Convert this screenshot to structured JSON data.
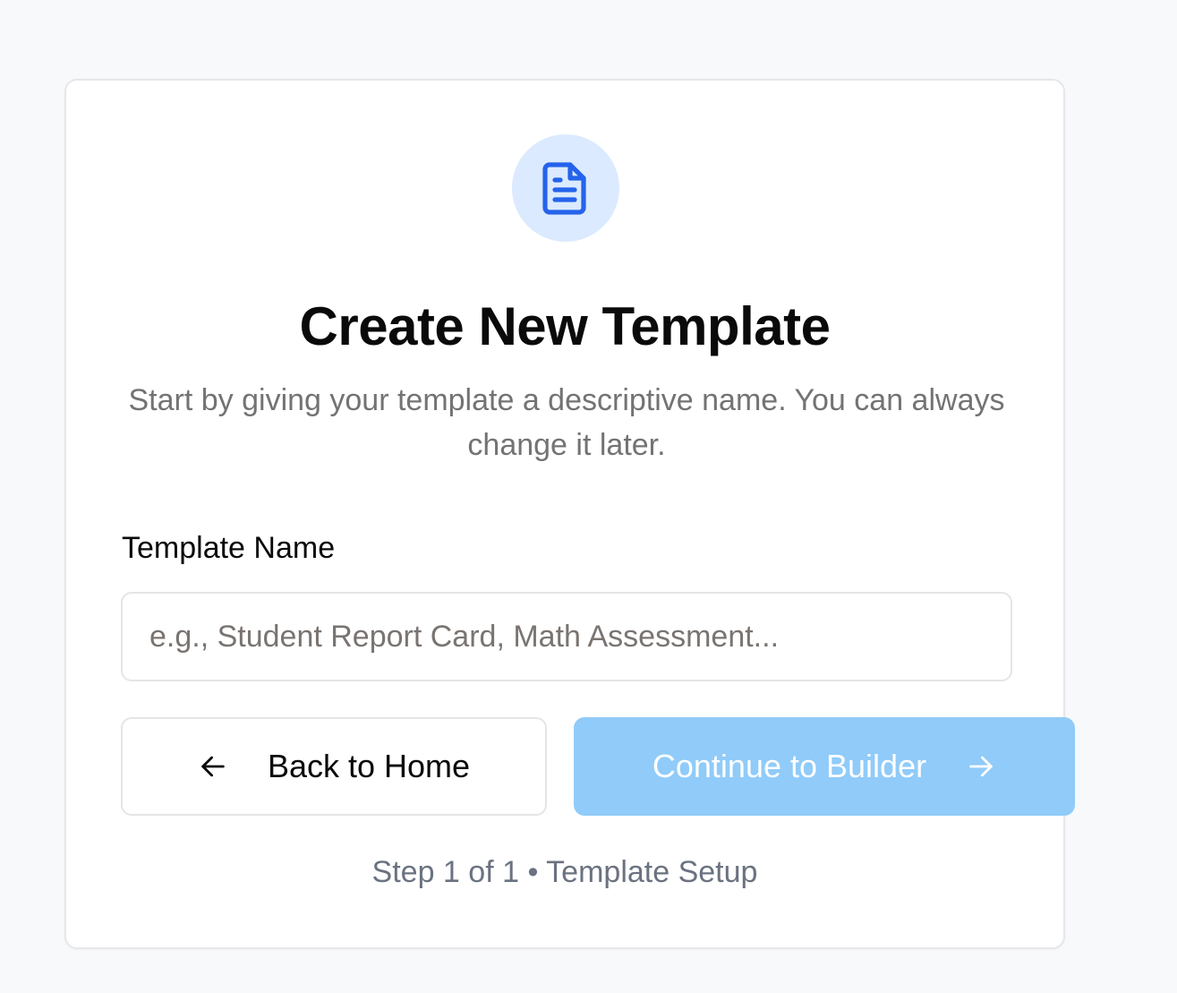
{
  "card": {
    "icon": "document-icon",
    "title": "Create New Template",
    "subtitle": "Start by giving your template a descriptive name. You can always change it later."
  },
  "form": {
    "label": "Template Name",
    "value": "",
    "placeholder": "e.g., Student Report Card, Math Assessment..."
  },
  "actions": {
    "back_label": "Back to Home",
    "back_icon": "arrow-left-icon",
    "continue_label": "Continue to Builder",
    "continue_icon": "arrow-right-icon",
    "continue_disabled": true
  },
  "footer": {
    "step_text": "Step 1 of 1 • Template Setup"
  },
  "colors": {
    "accent": "#2563eb",
    "icon_bg": "#dbeafe",
    "continue_bg": "#90cbf9",
    "page_bg": "#f8f9fa"
  }
}
